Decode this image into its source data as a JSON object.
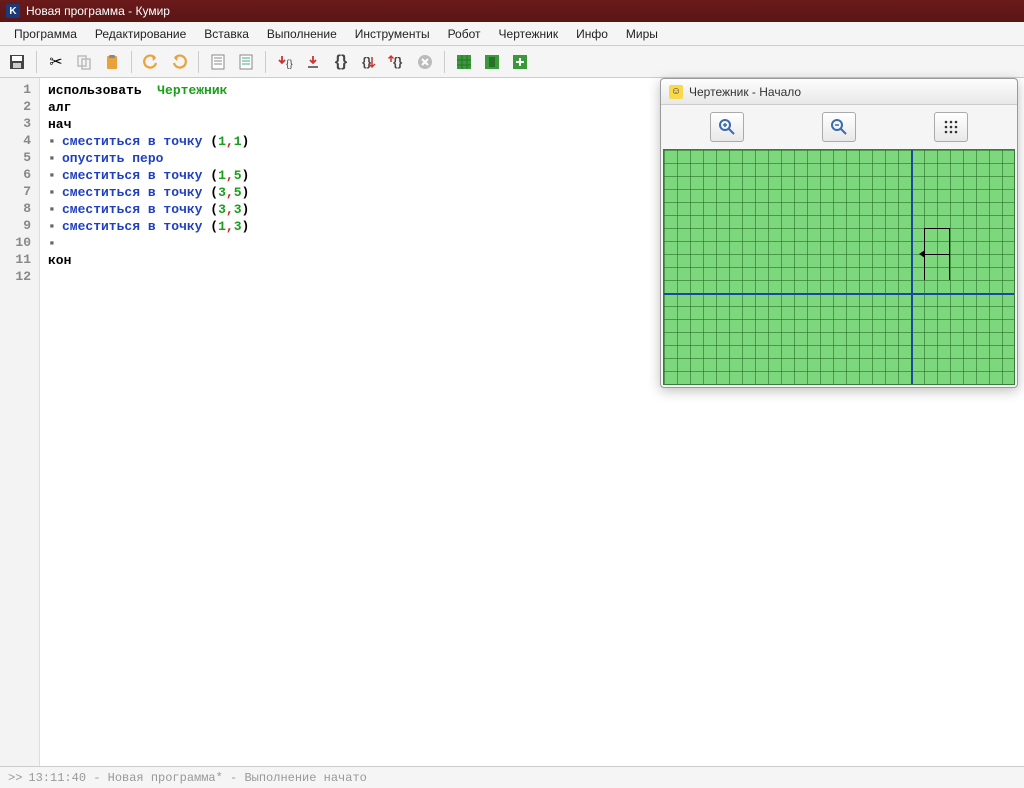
{
  "window": {
    "app_icon_letter": "K",
    "title": "Новая программа - Кумир"
  },
  "menu": {
    "items": [
      "Программа",
      "Редактирование",
      "Вставка",
      "Выполнение",
      "Инструменты",
      "Робот",
      "Чертежник",
      "Инфо",
      "Миры"
    ]
  },
  "code": {
    "lines": [
      {
        "n": "1",
        "type": "use",
        "use_kw": "использовать",
        "module": "Чертежник"
      },
      {
        "n": "2",
        "type": "decl",
        "text": "алг"
      },
      {
        "n": "3",
        "type": "decl",
        "text": "нач"
      },
      {
        "n": "4",
        "type": "cmdpt",
        "cmd": "сместиться в точку",
        "a": "1",
        "b": "1"
      },
      {
        "n": "5",
        "type": "cmd",
        "cmd": "опустить перо"
      },
      {
        "n": "6",
        "type": "cmdpt",
        "cmd": "сместиться в точку",
        "a": "1",
        "b": "5"
      },
      {
        "n": "7",
        "type": "cmdpt",
        "cmd": "сместиться в точку",
        "a": "3",
        "b": "5"
      },
      {
        "n": "8",
        "type": "cmdpt",
        "cmd": "сместиться в точку",
        "a": "3",
        "b": "3"
      },
      {
        "n": "9",
        "type": "cmdpt",
        "cmd": "сместиться в точку",
        "a": "1",
        "b": "3"
      },
      {
        "n": "10",
        "type": "bullet"
      },
      {
        "n": "11",
        "type": "decl",
        "text": "кон"
      },
      {
        "n": "12",
        "type": "blank"
      }
    ]
  },
  "drafter": {
    "title": "Чертежник - Начало"
  },
  "status": {
    "prompt": ">>",
    "text": "13:11:40 - Новая программа* - Выполнение начато"
  }
}
